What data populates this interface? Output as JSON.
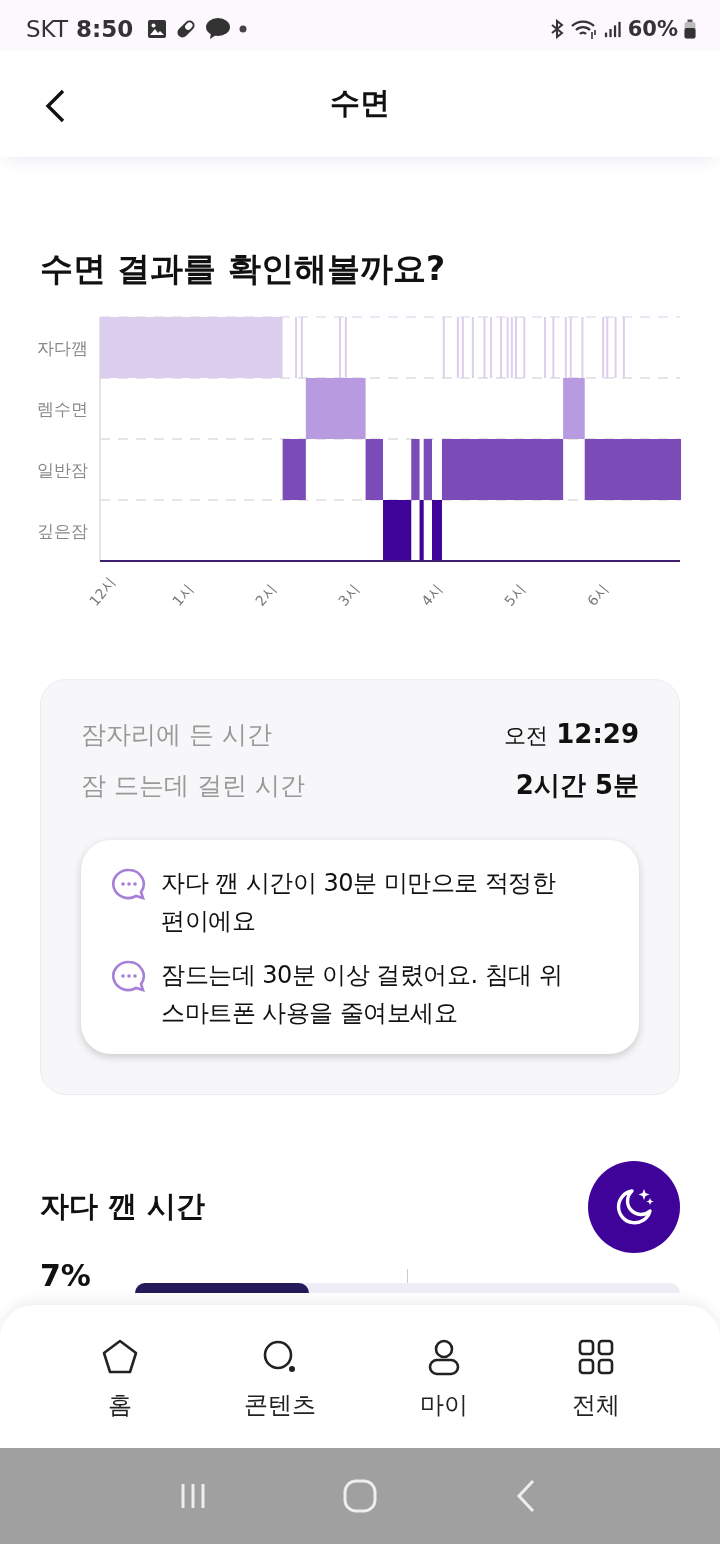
{
  "status_bar": {
    "carrier": "SKT",
    "time": "8:50",
    "battery": "60%"
  },
  "header": {
    "title": "수면"
  },
  "headline": "수면 결과를 확인해볼까요?",
  "sleep_chart": {
    "stage_labels": [
      "자다깸",
      "렘수면",
      "일반잠",
      "깊은잠"
    ],
    "hour_labels": [
      "12시",
      "1시",
      "2시",
      "3시",
      "4시",
      "5시",
      "6시"
    ]
  },
  "summary": {
    "rows": [
      {
        "label": "잠자리에 든 시간",
        "value_prefix": "오전",
        "value": "12:29"
      },
      {
        "label": "잠 드는데 걸린 시간",
        "value": "2시간 5분"
      }
    ],
    "tips": [
      "자다 깬 시간이 30분 미만으로 적정한 편이에요",
      "잠드는데 30분 이상 걸렸어요. 침대 위 스마트폰 사용을 줄여보세요"
    ]
  },
  "awake_section": {
    "title": "자다 깬 시간",
    "percent": "7%",
    "level": 0.32
  },
  "bottom_nav": [
    {
      "label": "홈",
      "selected": false
    },
    {
      "label": "콘텐츠",
      "selected": false
    },
    {
      "label": "마이",
      "selected": false
    },
    {
      "label": "전체",
      "selected": false
    }
  ]
}
